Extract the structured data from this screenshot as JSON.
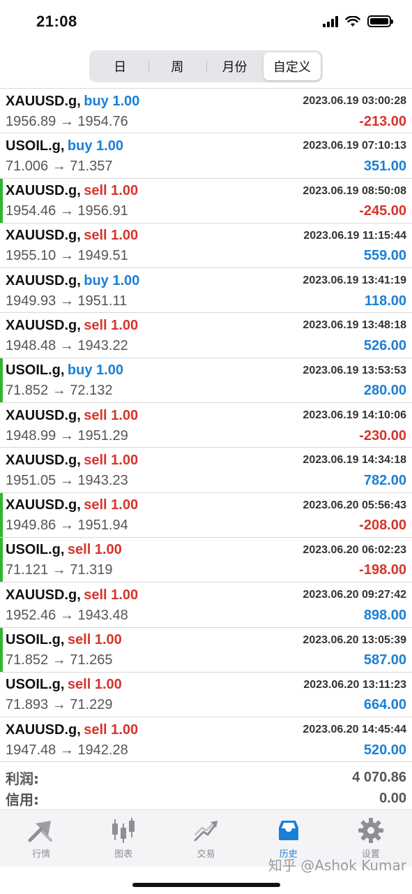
{
  "status": {
    "time": "21:08"
  },
  "tabs": {
    "day": "日",
    "week": "周",
    "month": "月份",
    "custom": "自定义"
  },
  "trades": [
    {
      "symbol": "XAUUSD.g,",
      "side": "buy",
      "volume": "buy 1.00",
      "time": "2023.06.19 03:00:28",
      "prices": "1956.89 → 1954.76",
      "profit": "-213.00",
      "marked": false
    },
    {
      "symbol": "USOIL.g,",
      "side": "buy",
      "volume": "buy 1.00",
      "time": "2023.06.19 07:10:13",
      "prices": "71.006 → 71.357",
      "profit": "351.00",
      "marked": false
    },
    {
      "symbol": "XAUUSD.g,",
      "side": "sell",
      "volume": "sell 1.00",
      "time": "2023.06.19 08:50:08",
      "prices": "1954.46 → 1956.91",
      "profit": "-245.00",
      "marked": true
    },
    {
      "symbol": "XAUUSD.g,",
      "side": "sell",
      "volume": "sell 1.00",
      "time": "2023.06.19 11:15:44",
      "prices": "1955.10 → 1949.51",
      "profit": "559.00",
      "marked": false
    },
    {
      "symbol": "XAUUSD.g,",
      "side": "buy",
      "volume": "buy 1.00",
      "time": "2023.06.19 13:41:19",
      "prices": "1949.93 → 1951.11",
      "profit": "118.00",
      "marked": false
    },
    {
      "symbol": "XAUUSD.g,",
      "side": "sell",
      "volume": "sell 1.00",
      "time": "2023.06.19 13:48:18",
      "prices": "1948.48 → 1943.22",
      "profit": "526.00",
      "marked": false
    },
    {
      "symbol": "USOIL.g,",
      "side": "buy",
      "volume": "buy 1.00",
      "time": "2023.06.19 13:53:53",
      "prices": "71.852 → 72.132",
      "profit": "280.00",
      "marked": true
    },
    {
      "symbol": "XAUUSD.g,",
      "side": "sell",
      "volume": "sell 1.00",
      "time": "2023.06.19 14:10:06",
      "prices": "1948.99 → 1951.29",
      "profit": "-230.00",
      "marked": false
    },
    {
      "symbol": "XAUUSD.g,",
      "side": "sell",
      "volume": "sell 1.00",
      "time": "2023.06.19 14:34:18",
      "prices": "1951.05 → 1943.23",
      "profit": "782.00",
      "marked": false
    },
    {
      "symbol": "XAUUSD.g,",
      "side": "sell",
      "volume": "sell 1.00",
      "time": "2023.06.20 05:56:43",
      "prices": "1949.86 → 1951.94",
      "profit": "-208.00",
      "marked": true
    },
    {
      "symbol": "USOIL.g,",
      "side": "sell",
      "volume": "sell 1.00",
      "time": "2023.06.20 06:02:23",
      "prices": "71.121 → 71.319",
      "profit": "-198.00",
      "marked": true
    },
    {
      "symbol": "XAUUSD.g,",
      "side": "sell",
      "volume": "sell 1.00",
      "time": "2023.06.20 09:27:42",
      "prices": "1952.46 → 1943.48",
      "profit": "898.00",
      "marked": false
    },
    {
      "symbol": "USOIL.g,",
      "side": "sell",
      "volume": "sell 1.00",
      "time": "2023.06.20 13:05:39",
      "prices": "71.852 → 71.265",
      "profit": "587.00",
      "marked": true
    },
    {
      "symbol": "USOIL.g,",
      "side": "sell",
      "volume": "sell 1.00",
      "time": "2023.06.20 13:11:23",
      "prices": "71.893 → 71.229",
      "profit": "664.00",
      "marked": false
    },
    {
      "symbol": "XAUUSD.g,",
      "side": "sell",
      "volume": "sell 1.00",
      "time": "2023.06.20 14:45:44",
      "prices": "1947.48 → 1942.28",
      "profit": "520.00",
      "marked": false
    }
  ],
  "summary": {
    "profit_label": "利润:",
    "profit_value": "4 070.86",
    "credit_label": "信用:",
    "credit_value": "0.00"
  },
  "tabbar": [
    {
      "label": "行情",
      "icon": "quotes-icon",
      "active": false
    },
    {
      "label": "图表",
      "icon": "chart-icon",
      "active": false
    },
    {
      "label": "交易",
      "icon": "trade-icon",
      "active": false
    },
    {
      "label": "历史",
      "icon": "history-icon",
      "active": true
    },
    {
      "label": "设置",
      "icon": "settings-icon",
      "active": false
    }
  ],
  "colors": {
    "buy": "#1a7fd6",
    "sell": "#d6342c",
    "marker": "#2fb52f"
  },
  "watermark": "知乎 @Ashok Kumar"
}
